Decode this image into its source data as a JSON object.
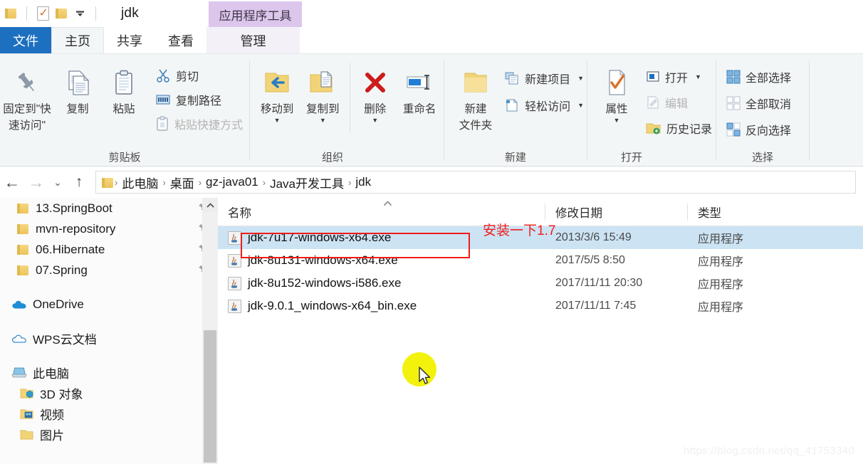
{
  "window": {
    "title": "jdk",
    "contextual_tab_group": "应用程序工具",
    "quick_access": [
      {
        "name": "folder-icon",
        "label": "属性"
      },
      {
        "name": "properties-icon",
        "label": "属性"
      },
      {
        "name": "new-folder-icon",
        "label": "新建文件夹"
      },
      {
        "name": "customize-caret",
        "label": "▾"
      }
    ]
  },
  "tabs": [
    {
      "label": "文件",
      "state": "file"
    },
    {
      "label": "主页",
      "state": "active"
    },
    {
      "label": "共享",
      "state": "normal"
    },
    {
      "label": "查看",
      "state": "normal"
    },
    {
      "label": "管理",
      "state": "contextual"
    }
  ],
  "ribbon": {
    "groups": [
      {
        "label": "剪贴板",
        "big_buttons": [
          {
            "label": "固定到\"快\n速访问\"",
            "line1": "固定到\"快",
            "line2": "速访问\"",
            "icon": "pin-icon"
          },
          {
            "label": "复制",
            "line1": "复制",
            "line2": "",
            "icon": "copy-icon"
          },
          {
            "label": "粘贴",
            "line1": "粘贴",
            "line2": "",
            "icon": "paste-icon"
          }
        ],
        "small_buttons": [
          {
            "label": "剪切",
            "icon": "scissors-icon",
            "disabled": false
          },
          {
            "label": "复制路径",
            "icon": "copy-path-icon",
            "disabled": false
          },
          {
            "label": "粘贴快捷方式",
            "icon": "paste-shortcut-icon",
            "disabled": true
          }
        ]
      },
      {
        "label": "组织",
        "big_buttons": [
          {
            "label": "移动到",
            "line1": "移动到",
            "line2": "",
            "icon": "move-to-icon",
            "has_dropdown": true
          },
          {
            "label": "复制到",
            "line1": "复制到",
            "line2": "",
            "icon": "copy-to-icon",
            "has_dropdown": true
          },
          {
            "label": "删除",
            "line1": "删除",
            "line2": "",
            "icon": "delete-x-icon",
            "has_dropdown": true
          },
          {
            "label": "重命名",
            "line1": "重命名",
            "line2": "",
            "icon": "rename-icon",
            "has_dropdown": false
          }
        ],
        "small_buttons": []
      },
      {
        "label": "新建",
        "big_buttons": [
          {
            "label": "新建\n文件夹",
            "line1": "新建",
            "line2": "文件夹",
            "icon": "new-folder-icon",
            "has_dropdown": false
          }
        ],
        "small_buttons": [
          {
            "label": "新建项目",
            "icon": "new-item-icon",
            "has_dropdown": true
          },
          {
            "label": "轻松访问",
            "icon": "easy-access-icon",
            "has_dropdown": true
          }
        ]
      },
      {
        "label": "打开",
        "big_buttons": [
          {
            "label": "属性",
            "line1": "属性",
            "line2": "",
            "icon": "properties-icon",
            "has_dropdown": true
          }
        ],
        "small_buttons": [
          {
            "label": "打开",
            "icon": "open-icon",
            "has_dropdown": true,
            "disabled": false
          },
          {
            "label": "编辑",
            "icon": "edit-icon",
            "disabled": true
          },
          {
            "label": "历史记录",
            "icon": "history-icon",
            "disabled": false
          }
        ]
      },
      {
        "label": "选择",
        "big_buttons": [],
        "small_buttons": [
          {
            "label": "全部选择",
            "icon": "select-all-icon",
            "disabled": false
          },
          {
            "label": "全部取消",
            "icon": "select-none-icon",
            "disabled": true
          },
          {
            "label": "反向选择",
            "icon": "invert-selection-icon",
            "disabled": false
          }
        ]
      }
    ]
  },
  "addressbar": {
    "back": "←",
    "forward": "→",
    "history": "⌄",
    "up": "↑",
    "breadcrumbs": [
      "此电脑",
      "桌面",
      "gz-java01",
      "Java开发工具",
      "jdk"
    ],
    "separator": "›"
  },
  "navpane": {
    "items": [
      {
        "label": "13.SpringBoot",
        "icon": "folder-icon",
        "pinned": true,
        "indent": 1
      },
      {
        "label": "mvn-repository",
        "icon": "folder-icon",
        "pinned": true,
        "indent": 1
      },
      {
        "label": "06.Hibernate",
        "icon": "folder-icon",
        "pinned": true,
        "indent": 1
      },
      {
        "label": "07.Spring",
        "icon": "folder-icon",
        "pinned": true,
        "indent": 1
      },
      {
        "label": "OneDrive",
        "icon": "onedrive-cloud-icon",
        "pinned": false,
        "indent": 0
      },
      {
        "label": "WPS云文档",
        "icon": "wps-cloud-icon",
        "pinned": false,
        "indent": 0
      },
      {
        "label": "此电脑",
        "icon": "this-pc-icon",
        "pinned": false,
        "indent": 0
      },
      {
        "label": "3D 对象",
        "icon": "3d-objects-icon",
        "pinned": false,
        "indent": 1
      },
      {
        "label": "视频",
        "icon": "videos-icon",
        "pinned": false,
        "indent": 1
      },
      {
        "label": "图片",
        "icon": "pictures-icon",
        "pinned": false,
        "indent": 1
      }
    ]
  },
  "filelist": {
    "columns": [
      {
        "label": "名称",
        "sorted": true,
        "sort_dir": "asc"
      },
      {
        "label": "修改日期",
        "sorted": false
      },
      {
        "label": "类型",
        "sorted": false
      }
    ],
    "rows": [
      {
        "name": "jdk-7u17-windows-x64.exe",
        "date": "2013/3/6 15:49",
        "type": "应用程序",
        "selected": true
      },
      {
        "name": "jdk-8u131-windows-x64.exe",
        "date": "2017/5/5 8:50",
        "type": "应用程序",
        "selected": false
      },
      {
        "name": "jdk-8u152-windows-i586.exe",
        "date": "2017/11/11 20:30",
        "type": "应用程序",
        "selected": false
      },
      {
        "name": "jdk-9.0.1_windows-x64_bin.exe",
        "date": "2017/11/11 7:45",
        "type": "应用程序",
        "selected": false
      }
    ]
  },
  "annotation": {
    "text": "安装一下1.7",
    "color": "#f01d1d"
  },
  "watermark": "https://blog.csdn.net/qq_41753340",
  "colors": {
    "file_tab": "#1d6fc0",
    "contextual_tab": "#ddc6ec",
    "selection": "#cce3f3",
    "ribbon_bg": "#f3f6f7",
    "annotation_red": "#ef1b1b",
    "cursor_highlight": "#f2f20d"
  }
}
